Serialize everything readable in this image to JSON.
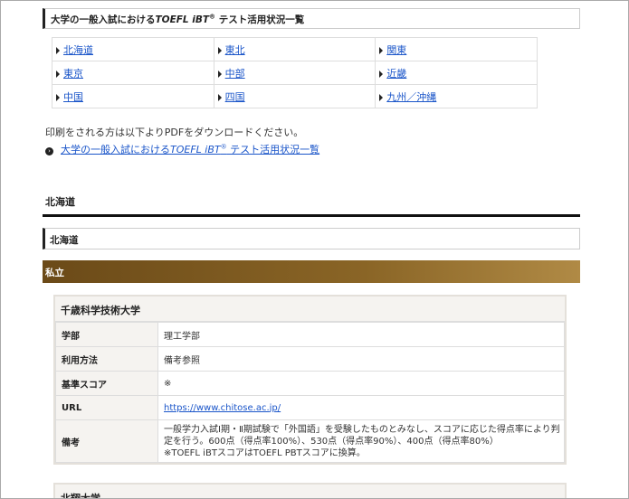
{
  "title": {
    "prefix": "大学の一般入試における",
    "brand": "TOEFL iBT",
    "reg": "®",
    "suffix": " テスト活用状況一覧"
  },
  "regions": [
    [
      "北海道",
      "東北",
      "関東"
    ],
    [
      "東京",
      "中部",
      "近畿"
    ],
    [
      "中国",
      "四国",
      "九州／沖縄"
    ]
  ],
  "print_note": "印刷をされる方は以下よりPDFをダウンロードください。",
  "pdf_link": {
    "prefix": "大学の一般入試における",
    "brand": "TOEFL iBT",
    "reg": "®",
    "suffix": " テスト活用状況一覧"
  },
  "section_title": "北海道",
  "sub_title": "北海道",
  "category_band": "私立",
  "universities": [
    {
      "name": "千歳科学技術大学",
      "rows": [
        {
          "key": "学部",
          "value": "理工学部"
        },
        {
          "key": "利用方法",
          "value": "備考参照"
        },
        {
          "key": "基準スコア",
          "value": "※"
        },
        {
          "key": "URL",
          "value": "https://www.chitose.ac.jp/"
        },
        {
          "key": "備考",
          "value": "一般学力入試Ⅰ期・Ⅱ期試験で「外国語」を受験したものとみなし、スコアに応じた得点率により判定を行う。600点（得点率100%）、530点（得点率90%）、400点（得点率80%）",
          "value2": "※TOEFL iBTスコアはTOEFL PBTスコアに換算。"
        }
      ]
    },
    {
      "name": "北翔大学"
    }
  ],
  "colors": {
    "link": "#1a55c9",
    "band_start": "#6b4a18",
    "band_end": "#b08a45",
    "card_border": "#e4e0da",
    "key_bg": "#f5f3f0"
  }
}
